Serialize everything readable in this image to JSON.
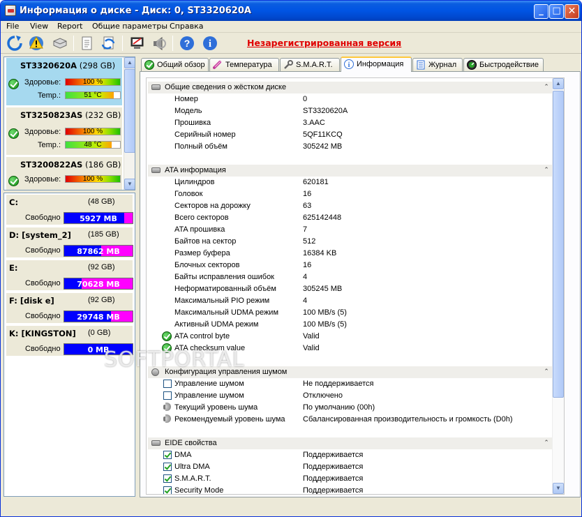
{
  "window": {
    "title": "Информация о диске - Диск: 0, ST3320620A",
    "buttons": {
      "minimize": "_",
      "maximize": "□",
      "close": "✕"
    }
  },
  "menu": [
    "File",
    "View",
    "Report",
    "Общие параметры",
    "Справка"
  ],
  "toolbar": {
    "icons": [
      "refresh-icon",
      "warning-icon",
      "disk-icon",
      "report-icon",
      "sync-icon",
      "monitor-icon",
      "speaker-icon",
      "help-icon",
      "info-icon"
    ],
    "unregistered": "Незарегистрированная версия"
  },
  "disks": [
    {
      "name": "ST3320620A",
      "size": "(298 GB)",
      "health_label": "Здоровье:",
      "health": "100 %",
      "health_pct": 100,
      "temp_label": "Temp.:",
      "temp": "51 °C",
      "temp_pct": 88,
      "selected": true
    },
    {
      "name": "ST3250823AS",
      "size": "(232 GB)",
      "health_label": "Здоровье:",
      "health": "100 %",
      "health_pct": 100,
      "temp_label": "Temp.:",
      "temp": "48 °C",
      "temp_pct": 84,
      "selected": false
    },
    {
      "name": "ST3200822AS",
      "size": "(186 GB)",
      "health_label": "Здоровье:",
      "health": "100 %",
      "health_pct": 100
    }
  ],
  "partitions": [
    {
      "name": "C:",
      "size": "(48 GB)",
      "free_label": "Свободно",
      "free": "5927 MB",
      "free_frac": 0.88
    },
    {
      "name": "D: [system_2]",
      "size": "(185 GB)",
      "free_label": "Свободно",
      "free": "87862 MB",
      "free_frac": 0.54
    },
    {
      "name": "E:",
      "size": "(92 GB)",
      "free_label": "Свободно",
      "free": "70628 MB",
      "free_frac": 0.25
    },
    {
      "name": "F: [disk e]",
      "size": "(92 GB)",
      "free_label": "Свободно",
      "free": "29748 MB",
      "free_frac": 0.68
    },
    {
      "name": "K: [KINGSTON]",
      "size": "(0 GB)",
      "free_label": "Свободно",
      "free": "0 MB",
      "free_frac": 0.0
    }
  ],
  "tabs": [
    {
      "label": "Общий обзор",
      "icon": "check-icon"
    },
    {
      "label": "Температура",
      "icon": "thermometer-icon"
    },
    {
      "label": "S.M.A.R.T.",
      "icon": "wrench-icon"
    },
    {
      "label": "Информация",
      "icon": "info-icon",
      "active": true
    },
    {
      "label": "Журнал",
      "icon": "log-icon"
    },
    {
      "label": "Быстродействие",
      "icon": "speed-icon"
    }
  ],
  "sections": {
    "general": {
      "title": "Общие сведения о жёстком диске",
      "rows": [
        {
          "k": "Номер",
          "v": "0"
        },
        {
          "k": "Модель",
          "v": "ST3320620A"
        },
        {
          "k": "Прошивка",
          "v": "3.AAC"
        },
        {
          "k": "Серийный номер",
          "v": "5QF11KCQ"
        },
        {
          "k": "Полный объём",
          "v": "305242 MB"
        }
      ]
    },
    "ata": {
      "title": "ATA информация",
      "rows": [
        {
          "k": "Цилиндров",
          "v": "620181"
        },
        {
          "k": "Головок",
          "v": "16"
        },
        {
          "k": "Секторов на дорожку",
          "v": "63"
        },
        {
          "k": "Всего секторов",
          "v": "625142448"
        },
        {
          "k": "ATA прошивка",
          "v": "7"
        },
        {
          "k": "Байтов на сектор",
          "v": "512"
        },
        {
          "k": "Размер буфера",
          "v": "16384 KB"
        },
        {
          "k": "Блочных секторов",
          "v": "16"
        },
        {
          "k": "Байты исправления ошибок",
          "v": "4"
        },
        {
          "k": "Неформатированный объём",
          "v": "305245 MB"
        },
        {
          "k": "Максимальный PIO режим",
          "v": "4"
        },
        {
          "k": "Максимальный UDMA режим",
          "v": "100 MB/s (5)"
        },
        {
          "k": "Активный UDMA режим",
          "v": "100 MB/s (5)"
        },
        {
          "k": "ATA control byte",
          "v": "Valid",
          "icon": "ok"
        },
        {
          "k": "ATA checksum value",
          "v": "Valid",
          "icon": "ok"
        }
      ]
    },
    "noise": {
      "title": "Конфигурация управления шумом",
      "rows": [
        {
          "k": "Управление шумом",
          "v": "Не поддерживается",
          "icon": "box"
        },
        {
          "k": "Управление шумом",
          "v": "Отключено",
          "icon": "box"
        },
        {
          "k": "Текущий уровень шума",
          "v": "По умолчанию (00h)",
          "icon": "speaker"
        },
        {
          "k": "Рекомендуемый уровень шума",
          "v": "Сбалансированная производительность и громкость (D0h)",
          "icon": "speaker"
        }
      ]
    },
    "eide": {
      "title": "EIDE свойства",
      "rows": [
        {
          "k": "DMA",
          "v": "Поддерживается",
          "icon": "checked"
        },
        {
          "k": "Ultra DMA",
          "v": "Поддерживается",
          "icon": "checked"
        },
        {
          "k": "S.M.A.R.T.",
          "v": "Поддерживается",
          "icon": "checked"
        },
        {
          "k": "Security Mode",
          "v": "Поддерживается",
          "icon": "checked"
        }
      ]
    }
  },
  "watermark": "SOFTPORTAL"
}
